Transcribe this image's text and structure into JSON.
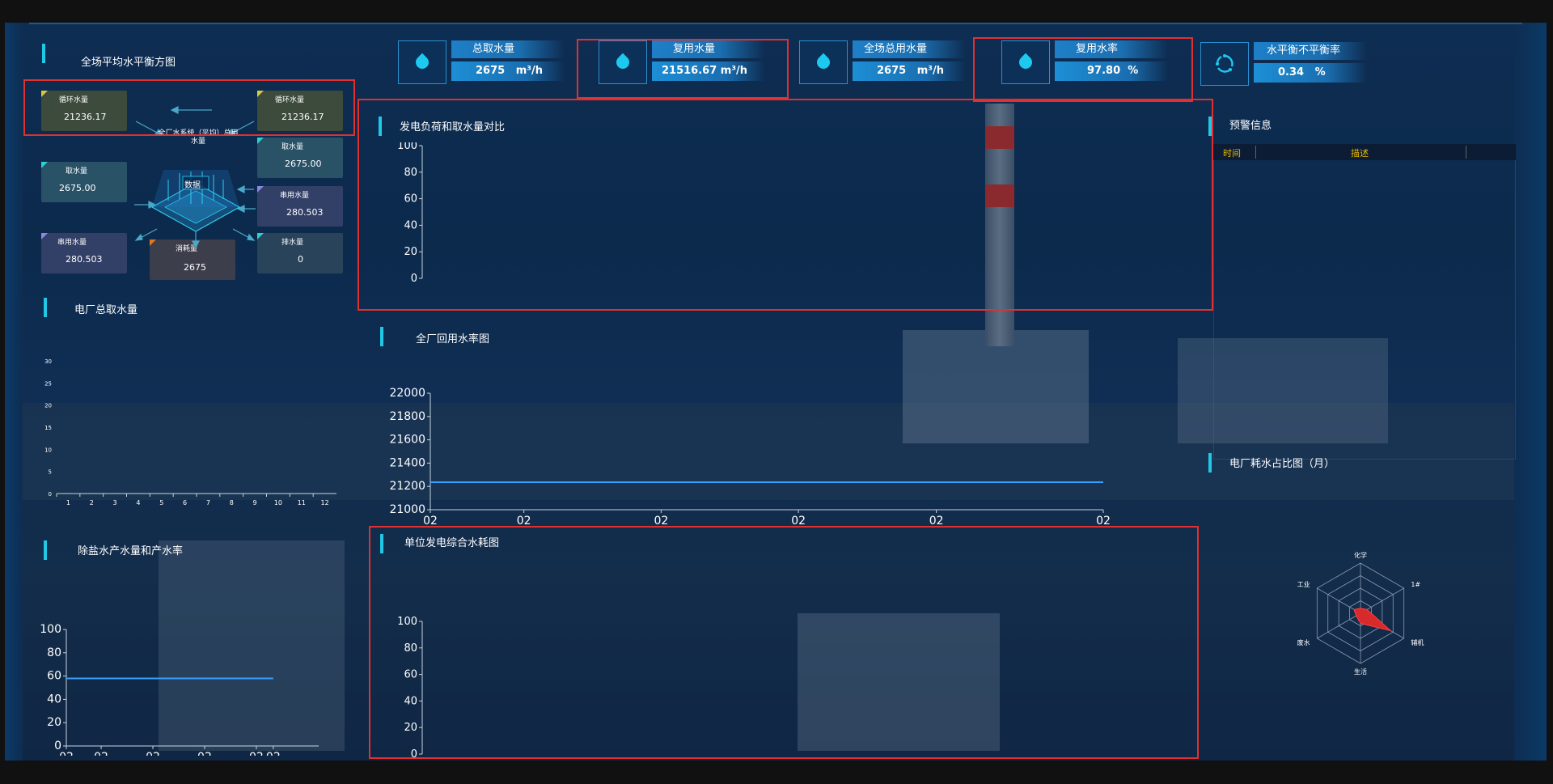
{
  "colors": {
    "accent": "#21c8e6",
    "highlight": "#e03030",
    "line": "#3aa0ff",
    "warn_header": "#e8b800"
  },
  "top_stats": [
    {
      "label": "总取水量",
      "value": "2675",
      "unit": "m³/h",
      "icon": "water-drop-icon"
    },
    {
      "label": "复用水量",
      "value": "21516.67",
      "unit": "m³/h",
      "icon": "water-drop-icon"
    },
    {
      "label": "全场总用水量",
      "value": "2675",
      "unit": "m³/h",
      "icon": "water-drop-icon"
    },
    {
      "label": "复用水率",
      "value": "97.80",
      "unit": "%",
      "icon": "water-drop-icon"
    },
    {
      "label": "水平衡不平衡率",
      "value": "0.34",
      "unit": "%",
      "icon": "recycle-icon"
    }
  ],
  "balance": {
    "title": "全场平均水平衡方图",
    "center_label": "全厂水系统（平均）总用水量",
    "center_badge": "数据",
    "boxes": [
      {
        "label": "循环水量",
        "value": "21236.17"
      },
      {
        "label": "循环水量",
        "value": "21236.17"
      },
      {
        "label": "取水量",
        "value": "2675.00"
      },
      {
        "label": "取水量",
        "value": "2675.00"
      },
      {
        "label": "串用水量",
        "value": "280.503"
      },
      {
        "label": "串用水量",
        "value": "280.503"
      },
      {
        "label": "消耗量",
        "value": "2675"
      },
      {
        "label": "排水量",
        "value": "0"
      }
    ]
  },
  "intake_chart": {
    "title": "电厂总取水量",
    "chart_data": {
      "type": "bar",
      "categories": [
        "1",
        "2",
        "3",
        "4",
        "5",
        "6",
        "7",
        "8",
        "9",
        "10",
        "11",
        "12"
      ],
      "values": [],
      "ylim": [
        0,
        30
      ],
      "yticks": [
        "0",
        "5",
        "10",
        "15",
        "20",
        "25",
        "30"
      ]
    }
  },
  "desalt_chart": {
    "title": "除盐水产水量和产水率",
    "chart_data": {
      "type": "line",
      "x": [
        "02",
        "02",
        "02",
        "02",
        "02",
        "02"
      ],
      "series": [
        {
          "values": [
            58,
            58,
            58,
            58,
            58,
            58
          ]
        }
      ],
      "ylim": [
        0,
        100
      ],
      "yticks": [
        "0",
        "20",
        "40",
        "60",
        "80",
        "100"
      ]
    }
  },
  "load_chart": {
    "title": "发电负荷和取水量对比",
    "chart_data": {
      "type": "line",
      "x": [],
      "series": [],
      "ylim": [
        0,
        100
      ],
      "yticks": [
        "0",
        "20",
        "40",
        "60",
        "80",
        "100"
      ]
    }
  },
  "reuse_chart": {
    "title": "全厂回用水率图",
    "chart_data": {
      "type": "line",
      "x": [
        "02",
        "02",
        "02",
        "02",
        "02",
        "02"
      ],
      "series": [
        {
          "values": [
            21236,
            21236,
            21236,
            21236,
            21236,
            21236
          ]
        }
      ],
      "ylim": [
        21000,
        22000
      ],
      "yticks": [
        "21000",
        "21200",
        "21400",
        "21600",
        "21800",
        "22000"
      ]
    }
  },
  "unit_chart": {
    "title": "单位发电综合水耗图",
    "chart_data": {
      "type": "line",
      "x": [],
      "series": [],
      "ylim": [
        0,
        100
      ],
      "yticks": [
        "0",
        "20",
        "40",
        "60",
        "80",
        "100"
      ]
    }
  },
  "warning": {
    "title": "预警信息",
    "columns": [
      "时间",
      "描述"
    ],
    "rows": []
  },
  "radar": {
    "title": "电厂耗水占比图（月）",
    "chart_data": {
      "type": "radar",
      "indicators": [
        "化学",
        "1#",
        "辅机",
        "生活",
        "废水",
        "工业"
      ],
      "values": [
        0.1,
        0.15,
        0.7,
        0.2,
        0.1,
        0.15
      ]
    }
  }
}
